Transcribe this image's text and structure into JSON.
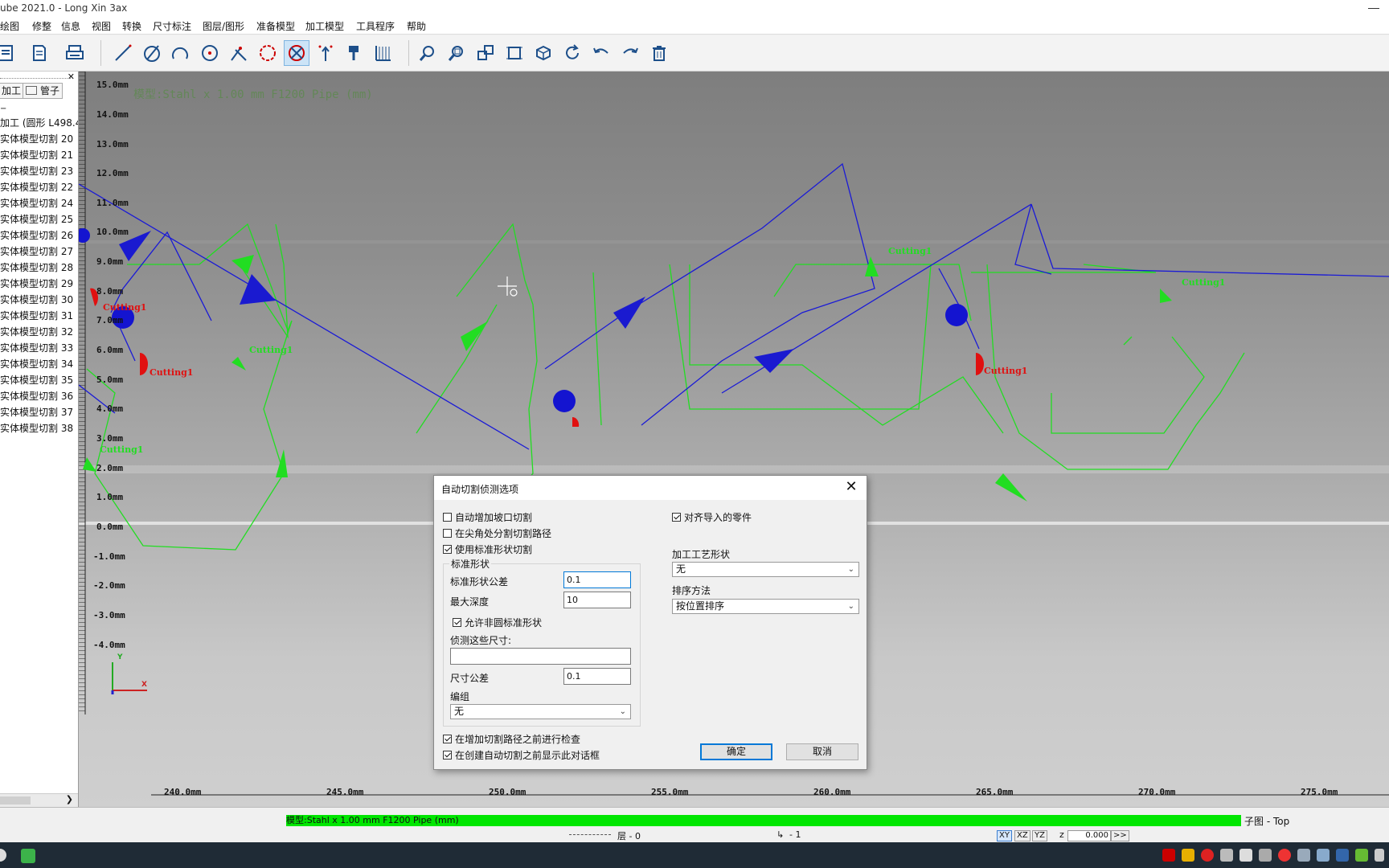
{
  "window": {
    "title": "ube 2021.0 - Long Xin 3ax"
  },
  "menu": [
    {
      "label": "绘图",
      "name": "menu-draw"
    },
    {
      "label": "修整",
      "name": "menu-trim"
    },
    {
      "label": "信息",
      "name": "menu-info"
    },
    {
      "label": "视图",
      "name": "menu-view"
    },
    {
      "label": "转换",
      "name": "menu-transform"
    },
    {
      "label": "尺寸标注",
      "name": "menu-dimension"
    },
    {
      "label": "图层/图形",
      "name": "menu-layer"
    },
    {
      "label": "准备模型",
      "name": "menu-prepare-model"
    },
    {
      "label": "加工模型",
      "name": "menu-machining-model"
    },
    {
      "label": "工具程序",
      "name": "menu-tools"
    },
    {
      "label": "帮助",
      "name": "menu-help"
    }
  ],
  "toolbar": [
    {
      "icon": "document-icon"
    },
    {
      "icon": "page-icon"
    },
    {
      "icon": "print-icon"
    },
    {
      "icon": "line-tool-icon"
    },
    {
      "icon": "circle-slash-icon"
    },
    {
      "icon": "arc-icon"
    },
    {
      "icon": "circle-center-icon"
    },
    {
      "icon": "cut-tool-icon"
    },
    {
      "icon": "contour-icon"
    },
    {
      "icon": "auto-cut-icon",
      "active": true
    },
    {
      "icon": "lead-in-icon"
    },
    {
      "icon": "marker-icon"
    },
    {
      "icon": "grid-ruler-icon"
    },
    {
      "icon": "zoom-icon"
    },
    {
      "icon": "zoom-window-icon"
    },
    {
      "icon": "layout-icon"
    },
    {
      "icon": "fit-icon"
    },
    {
      "icon": "iso-view-icon"
    },
    {
      "icon": "refresh-icon"
    },
    {
      "icon": "undo-icon"
    },
    {
      "icon": "redo-icon"
    },
    {
      "icon": "trash-icon"
    }
  ],
  "left_panel": {
    "tabs": [
      "加工",
      "管子"
    ],
    "tree": [
      "加工 (圆形 L498.4",
      "实体模型切割 20",
      "实体模型切割 21",
      "实体模型切割 23",
      "实体模型切割 22",
      "实体模型切割 24",
      "实体模型切割 25",
      "实体模型切割 26",
      "实体模型切割 27",
      "实体模型切割 28",
      "实体模型切割 29",
      "实体模型切割 30",
      "实体模型切割 31",
      "实体模型切割 32",
      "实体模型切割 33",
      "实体模型切割 34",
      "实体模型切割 35",
      "实体模型切割 36",
      "实体模型切割 37",
      "实体模型切割 38"
    ]
  },
  "viewport": {
    "model_caption": "模型:Stahl x 1.00 mm  F1200 Pipe (mm)",
    "y_axis_labels": [
      "15.0mm",
      "14.0mm",
      "13.0mm",
      "12.0mm",
      "11.0mm",
      "10.0mm",
      "9.0mm",
      "8.0mm",
      "7.0mm",
      "6.0mm",
      "5.0mm",
      "4.0mm",
      "3.0mm",
      "2.0mm",
      "1.0mm",
      "0.0mm",
      "-1.0mm",
      "-2.0mm",
      "-3.0mm",
      "-4.0mm"
    ],
    "x_axis_labels": [
      "240.0mm",
      "245.0mm",
      "250.0mm",
      "255.0mm",
      "260.0mm",
      "265.0mm",
      "270.0mm",
      "275.0mm"
    ],
    "cut_labels": [
      "Cutting1",
      "Cutting1",
      "Cutting1",
      "Cutting1",
      "Cutting1",
      "Cutting1",
      "Cutting1"
    ],
    "axis_y": "Y",
    "axis_x": "X"
  },
  "dialog": {
    "title": "自动切割侦测选项",
    "close": "✕",
    "auto_bevel": {
      "label": "自动增加坡口切割",
      "checked": false
    },
    "split_corners": {
      "label": "在尖角处分割切割路径",
      "checked": false
    },
    "use_std_shape": {
      "label": "使用标准形状切割",
      "checked": true
    },
    "std_group_label": "标准形状",
    "std_tolerance_label": "标准形状公差",
    "std_tolerance_value": "0.1",
    "max_depth_label": "最大深度",
    "max_depth_value": "10",
    "allow_non_round": {
      "label": "允许非圆标准形状",
      "checked": true
    },
    "detect_sizes_label": "侦测这些尺寸:",
    "detect_sizes_value": "",
    "size_tolerance_label": "尺寸公差",
    "size_tolerance_value": "0.1",
    "group_label": "编组",
    "group_value": "无",
    "align_imported": {
      "label": "对齐导入的零件",
      "checked": true
    },
    "process_shape_label": "加工工艺形状",
    "process_shape_value": "无",
    "sort_label": "排序方法",
    "sort_value": "按位置排序",
    "check_before": {
      "label": "在增加切割路径之前进行检查",
      "checked": true
    },
    "show_dialog": {
      "label": "在创建自动切割之前显示此对话框",
      "checked": true
    },
    "ok": "确定",
    "cancel": "取消"
  },
  "status": {
    "model": "模型:Stahl x 1.00 mm  F1200 Pipe (mm)",
    "view": "子图 - Top",
    "layer": "层 - 0",
    "index": "- 1",
    "plane_buttons": [
      "XY",
      "XZ",
      "YZ"
    ],
    "z_label": "z",
    "z_value": "0.000",
    "more": ">>"
  },
  "colors": {
    "model_bar": "#00e600",
    "path_blue": "#1a1ad6",
    "contour_green": "#22dd22",
    "lead_red": "#e01010"
  }
}
